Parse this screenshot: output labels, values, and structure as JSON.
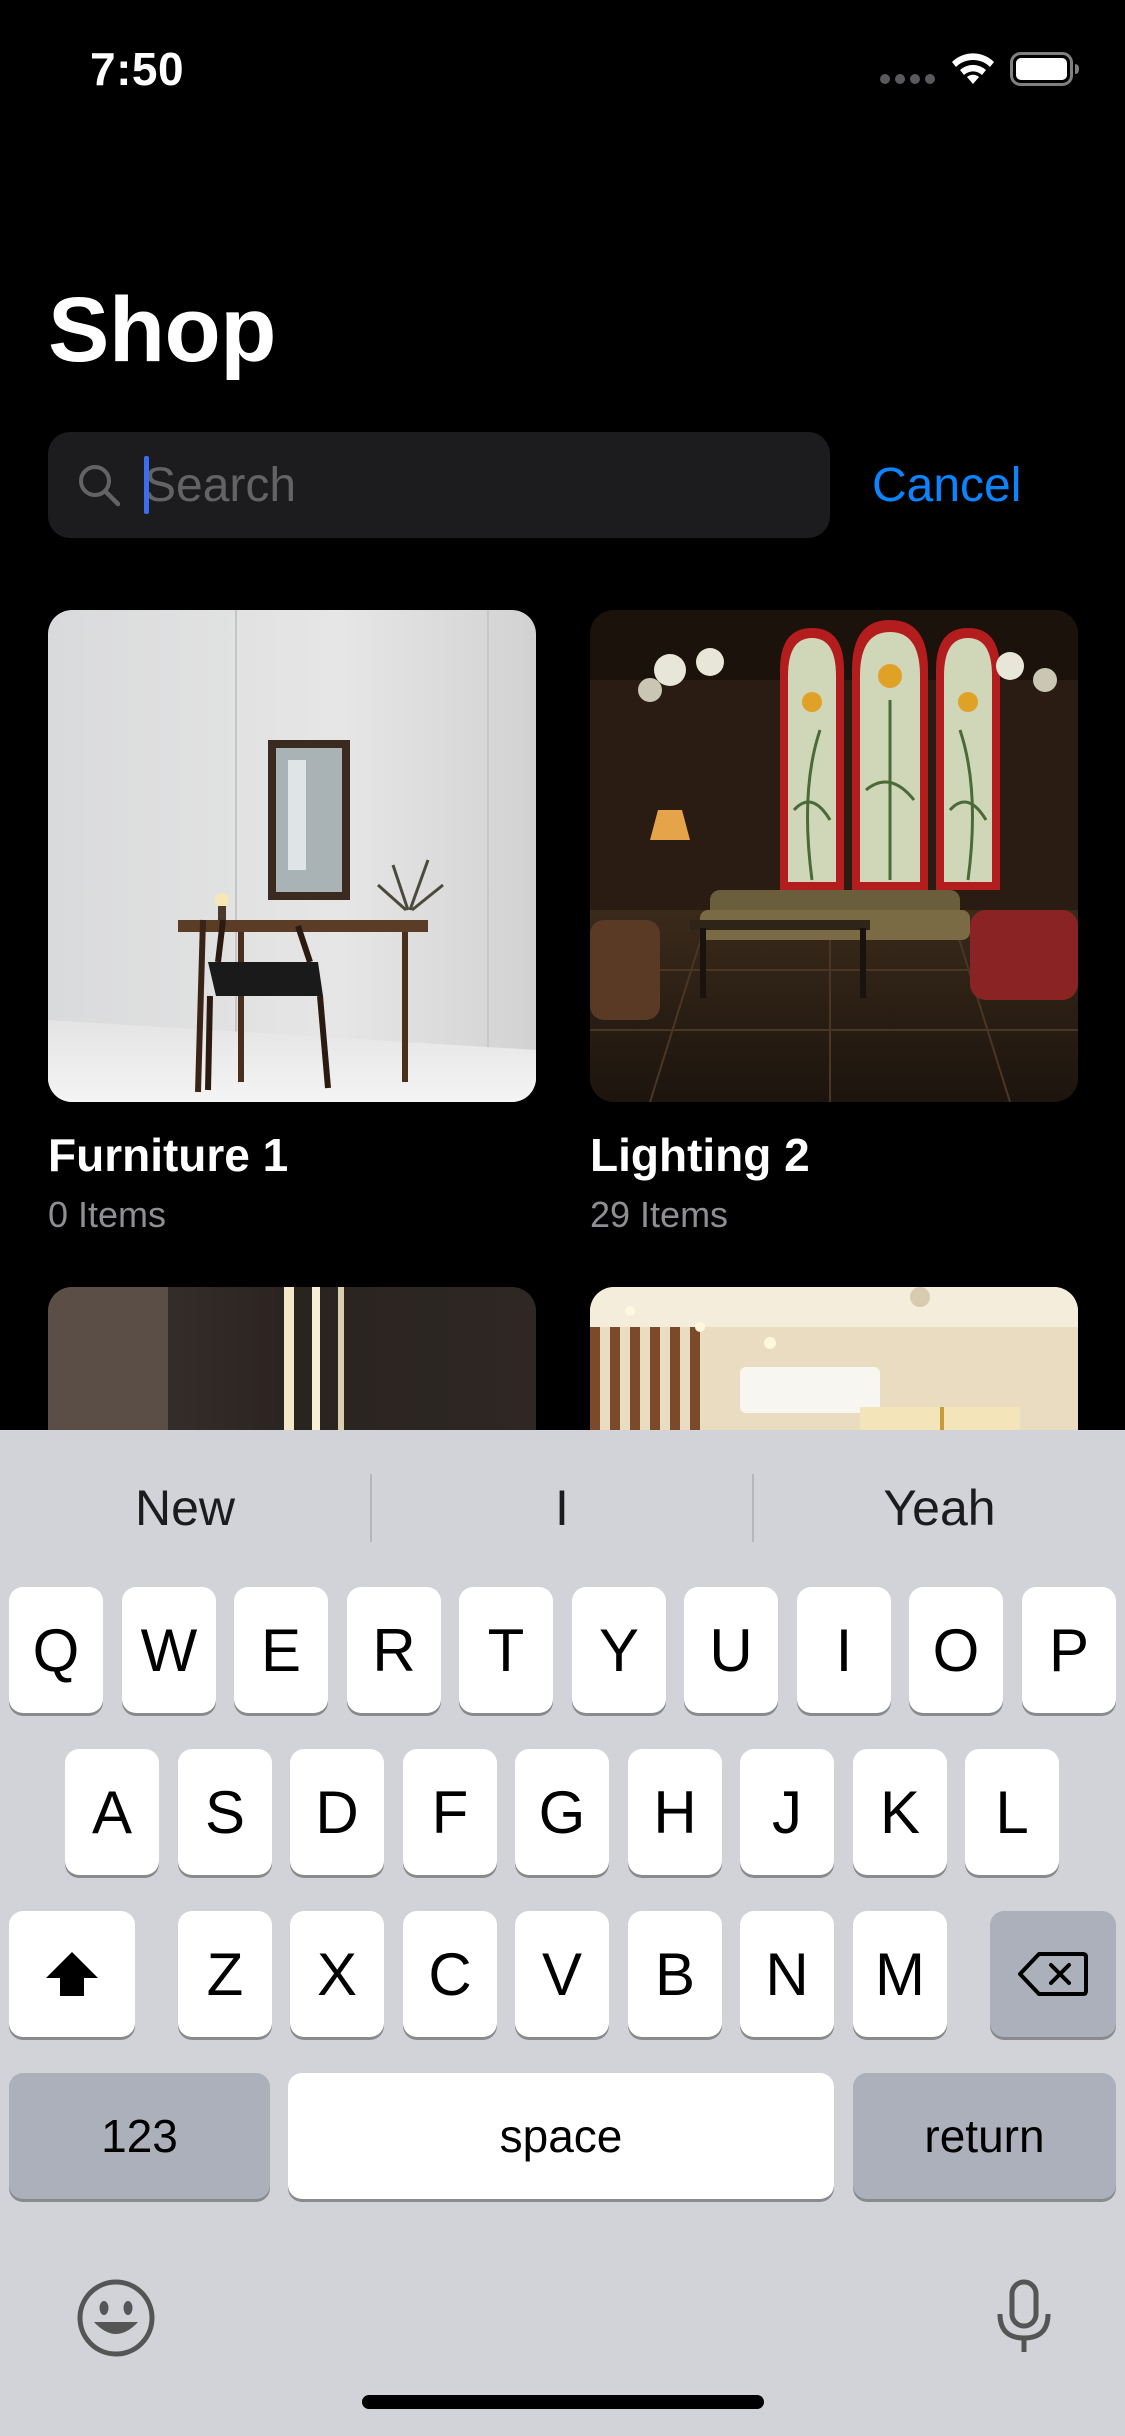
{
  "status_bar": {
    "time": "7:50"
  },
  "page": {
    "title": "Shop"
  },
  "search": {
    "placeholder": "Search",
    "value": "",
    "cancel_label": "Cancel"
  },
  "categories": [
    {
      "title": "Furniture 1",
      "count": "0 Items"
    },
    {
      "title": "Lighting 2",
      "count": "29 Items"
    },
    {
      "title": "",
      "count": ""
    },
    {
      "title": "",
      "count": ""
    }
  ],
  "keyboard": {
    "suggestions": [
      "New",
      "I",
      "Yeah"
    ],
    "row1": [
      "Q",
      "W",
      "E",
      "R",
      "T",
      "Y",
      "U",
      "I",
      "O",
      "P"
    ],
    "row2": [
      "A",
      "S",
      "D",
      "F",
      "G",
      "H",
      "J",
      "K",
      "L"
    ],
    "row3": [
      "Z",
      "X",
      "C",
      "V",
      "B",
      "N",
      "M"
    ],
    "numbers_label": "123",
    "space_label": "space",
    "return_label": "return",
    "icons": [
      "shift-icon",
      "delete-icon",
      "emoji-icon",
      "microphone-icon"
    ]
  },
  "colors": {
    "accent": "#0a84ff",
    "background": "#000000",
    "keyboard": "#d1d3d9"
  }
}
